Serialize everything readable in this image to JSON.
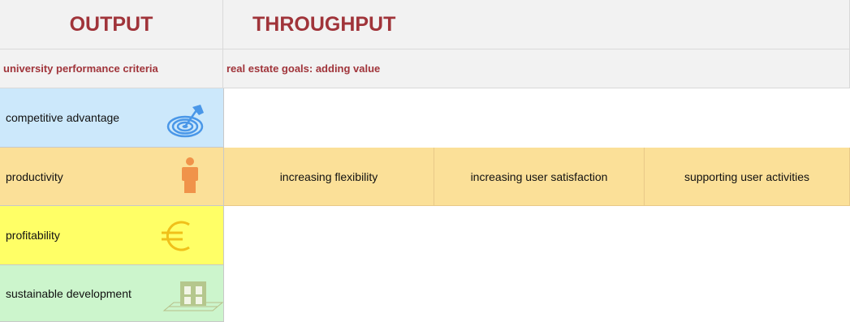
{
  "header": {
    "output_title": "OUTPUT",
    "throughput_title": "THROUGHPUT",
    "left_subtitle": "university performance criteria",
    "right_subtitle": "real estate goals: adding value"
  },
  "criteria": [
    {
      "label": "competitive advantage",
      "icon": "target-pin-icon",
      "color": "#cce8fb"
    },
    {
      "label": "productivity",
      "icon": "person-icon",
      "color": "#fbe098"
    },
    {
      "label": "profitability",
      "icon": "euro-icon",
      "color": "#ffff66"
    },
    {
      "label": "sustainable development",
      "icon": "house-icon",
      "color": "#ccf5cc"
    }
  ],
  "goals": [
    "increasing flexibility",
    "increasing user satisfaction",
    "supporting user activities"
  ],
  "colors": {
    "header_text": "#a0343a",
    "header_bg": "#f2f2f2",
    "goal_bg": "#fbe098"
  }
}
